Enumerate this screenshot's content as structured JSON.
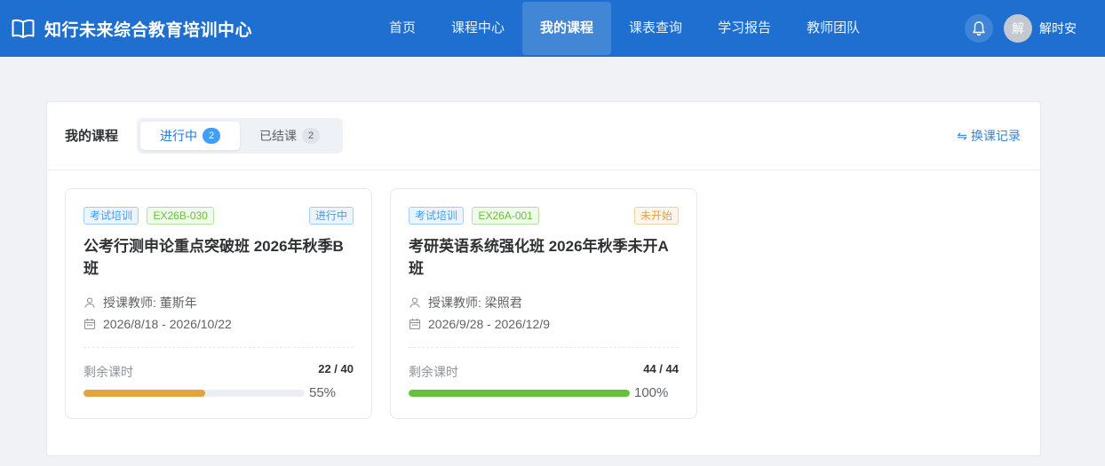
{
  "brand": {
    "title": "知行未来综合教育培训中心",
    "icon": "open-book-icon"
  },
  "nav": [
    {
      "label": "首页",
      "active": false
    },
    {
      "label": "课程中心",
      "active": false
    },
    {
      "label": "我的课程",
      "active": true
    },
    {
      "label": "课表查询",
      "active": false
    },
    {
      "label": "学习报告",
      "active": false
    },
    {
      "label": "教师团队",
      "active": false
    }
  ],
  "user": {
    "avatar_text": "解",
    "name": "解时安",
    "bell_icon": "bell-icon"
  },
  "panel": {
    "title": "我的课程",
    "tabs": [
      {
        "label": "进行中",
        "count": "2",
        "active": true
      },
      {
        "label": "已结课",
        "count": "2",
        "active": false
      }
    ],
    "history_label": "换课记录",
    "history_icon": "swap-icon"
  },
  "courses": [
    {
      "category": "考试培训",
      "code": "EX26B-030",
      "status": "进行中",
      "status_color": "#409eff",
      "name": "公考行测申论重点突破班 2026年秋季B班",
      "teacher_label": "授课教师:",
      "teacher": "董斯年",
      "dates": "2026/8/18 - 2026/10/22",
      "remain_label": "剩余课时",
      "remain": "22 / 40",
      "progress": 55,
      "progress_text": "55%",
      "bar_color": "#e6a23c"
    },
    {
      "category": "考试培训",
      "code": "EX26A-001",
      "status": "未开始",
      "status_color": "#e6a23c",
      "name": "考研英语系统强化班 2026年秋季未开A班",
      "teacher_label": "授课教师:",
      "teacher": "梁照君",
      "dates": "2026/9/28 - 2026/12/9",
      "remain_label": "剩余课时",
      "remain": "44 / 44",
      "progress": 100,
      "progress_text": "100%",
      "bar_color": "#67c23a"
    }
  ]
}
